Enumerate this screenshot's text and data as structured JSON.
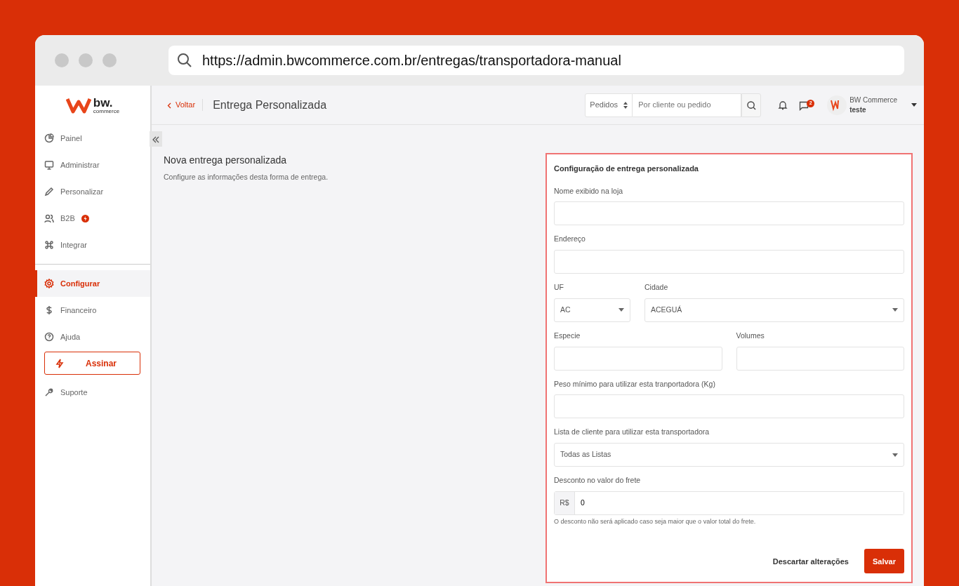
{
  "browser": {
    "url": "https://admin.bwcommerce.com.br/entregas/transportadora-manual"
  },
  "logo": {
    "name": "bw.",
    "tagline": "commerce"
  },
  "sidebar": {
    "items": [
      {
        "label": "Painel",
        "selected": false,
        "badge": false
      },
      {
        "label": "Administrar",
        "selected": false,
        "badge": false
      },
      {
        "label": "Personalizar",
        "selected": false,
        "badge": false
      },
      {
        "label": "B2B",
        "selected": false,
        "badge": true
      },
      {
        "label": "Integrar",
        "selected": false,
        "badge": false
      },
      {
        "label": "Configurar",
        "selected": true,
        "badge": false
      },
      {
        "label": "Financeiro",
        "selected": false,
        "badge": false
      },
      {
        "label": "Ajuda",
        "selected": false,
        "badge": false
      }
    ],
    "cta": "Assinar",
    "support": "Suporte"
  },
  "header": {
    "back": "Voltar",
    "title": "Entrega Personalizada",
    "search_scope": "Pedidos",
    "search_placeholder": "Por cliente ou pedido",
    "messages_count": "2",
    "user_name": "BW Commerce",
    "user_store": "teste"
  },
  "intro": {
    "title": "Nova entrega personalizada",
    "subtitle": "Configure as informações desta forma de entrega."
  },
  "form": {
    "title": "Configuração de entrega personalizada",
    "rows": [
      [
        {
          "label": "Nome exibido na loja",
          "kind": "text"
        }
      ],
      [
        {
          "label": "Endereço",
          "kind": "text"
        }
      ],
      [
        {
          "label": "UF",
          "kind": "select",
          "value": "AC"
        },
        {
          "label": "Cidade",
          "kind": "select",
          "value": "ACEGUÁ"
        }
      ],
      [
        {
          "label": "Especie",
          "kind": "text"
        },
        {
          "label": "Volumes",
          "kind": "text"
        }
      ],
      [
        {
          "label": "Peso mínimo para utilizar esta tranportadora (Kg)",
          "kind": "text"
        }
      ],
      [
        {
          "label": "Lista de cliente para utilizar esta transportadora",
          "kind": "select",
          "value": "Todas as Listas"
        }
      ],
      [
        {
          "label": "Desconto no valor do frete",
          "kind": "money",
          "prefix": "R$",
          "value": "0",
          "help": "O desconto não será aplicado caso seja maior que o valor total do frete."
        }
      ]
    ],
    "discard": "Descartar alterações",
    "save": "Salvar"
  }
}
